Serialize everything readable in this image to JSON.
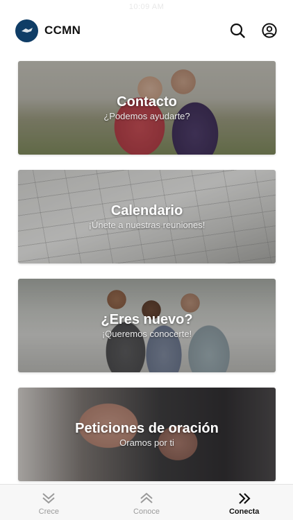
{
  "status_bar": {
    "time": "10:09 AM"
  },
  "header": {
    "title": "CCMN",
    "logo_icon": "ccmn-logo-icon",
    "actions": [
      "search-icon",
      "user-profile-icon"
    ]
  },
  "cards": [
    {
      "title": "Contacto",
      "subtitle": "¿Podemos ayudarte?"
    },
    {
      "title": "Calendario",
      "subtitle": "¡Únete a nuestras reuniones!"
    },
    {
      "title": "¿Eres nuevo?",
      "subtitle": "¡Queremos conocerte!"
    },
    {
      "title": "Peticiones de oración",
      "subtitle": "Oramos por ti"
    }
  ],
  "tabbar": {
    "tabs": [
      {
        "label": "Crece",
        "icon": "double-chevron-down-icon",
        "active": false
      },
      {
        "label": "Conoce",
        "icon": "double-chevron-up-icon",
        "active": false
      },
      {
        "label": "Conecta",
        "icon": "double-chevron-right-icon",
        "active": true
      }
    ]
  },
  "colors": {
    "logo_bg": "#0f3d66",
    "inactive_tab": "#9a9a9a",
    "active_tab": "#111111"
  }
}
